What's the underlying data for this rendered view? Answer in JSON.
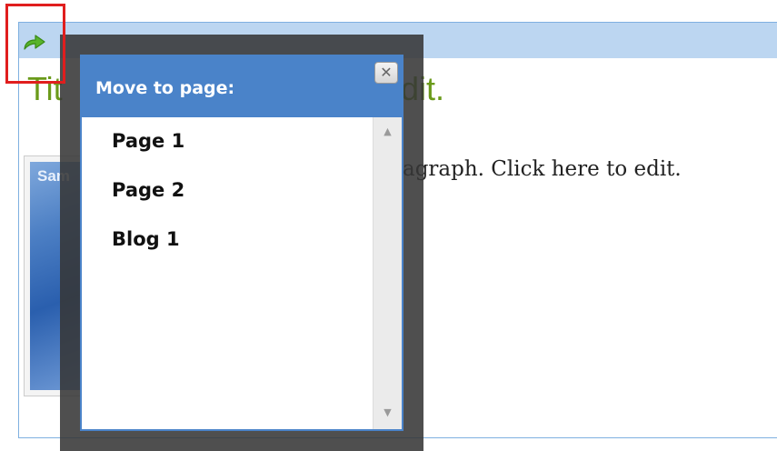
{
  "content_block": {
    "title_visible_start": "Tit",
    "title_visible_end": "dit.",
    "paragraph_visible": "agraph. Click here to edit.",
    "image_caption": "Sam",
    "move_icon": "green-arrow-icon"
  },
  "move_dialog": {
    "title": "Move to page:",
    "close_label": "✕",
    "pages": [
      "Page 1",
      "Page 2",
      "Blog 1"
    ],
    "scroll_up_icon": "▲",
    "scroll_down_icon": "▼"
  },
  "colors": {
    "dialog_header": "#4a83c9",
    "toolbar": "#bcd6f1",
    "title_green": "#6a9a1a",
    "highlight_red": "#e01e1e"
  }
}
